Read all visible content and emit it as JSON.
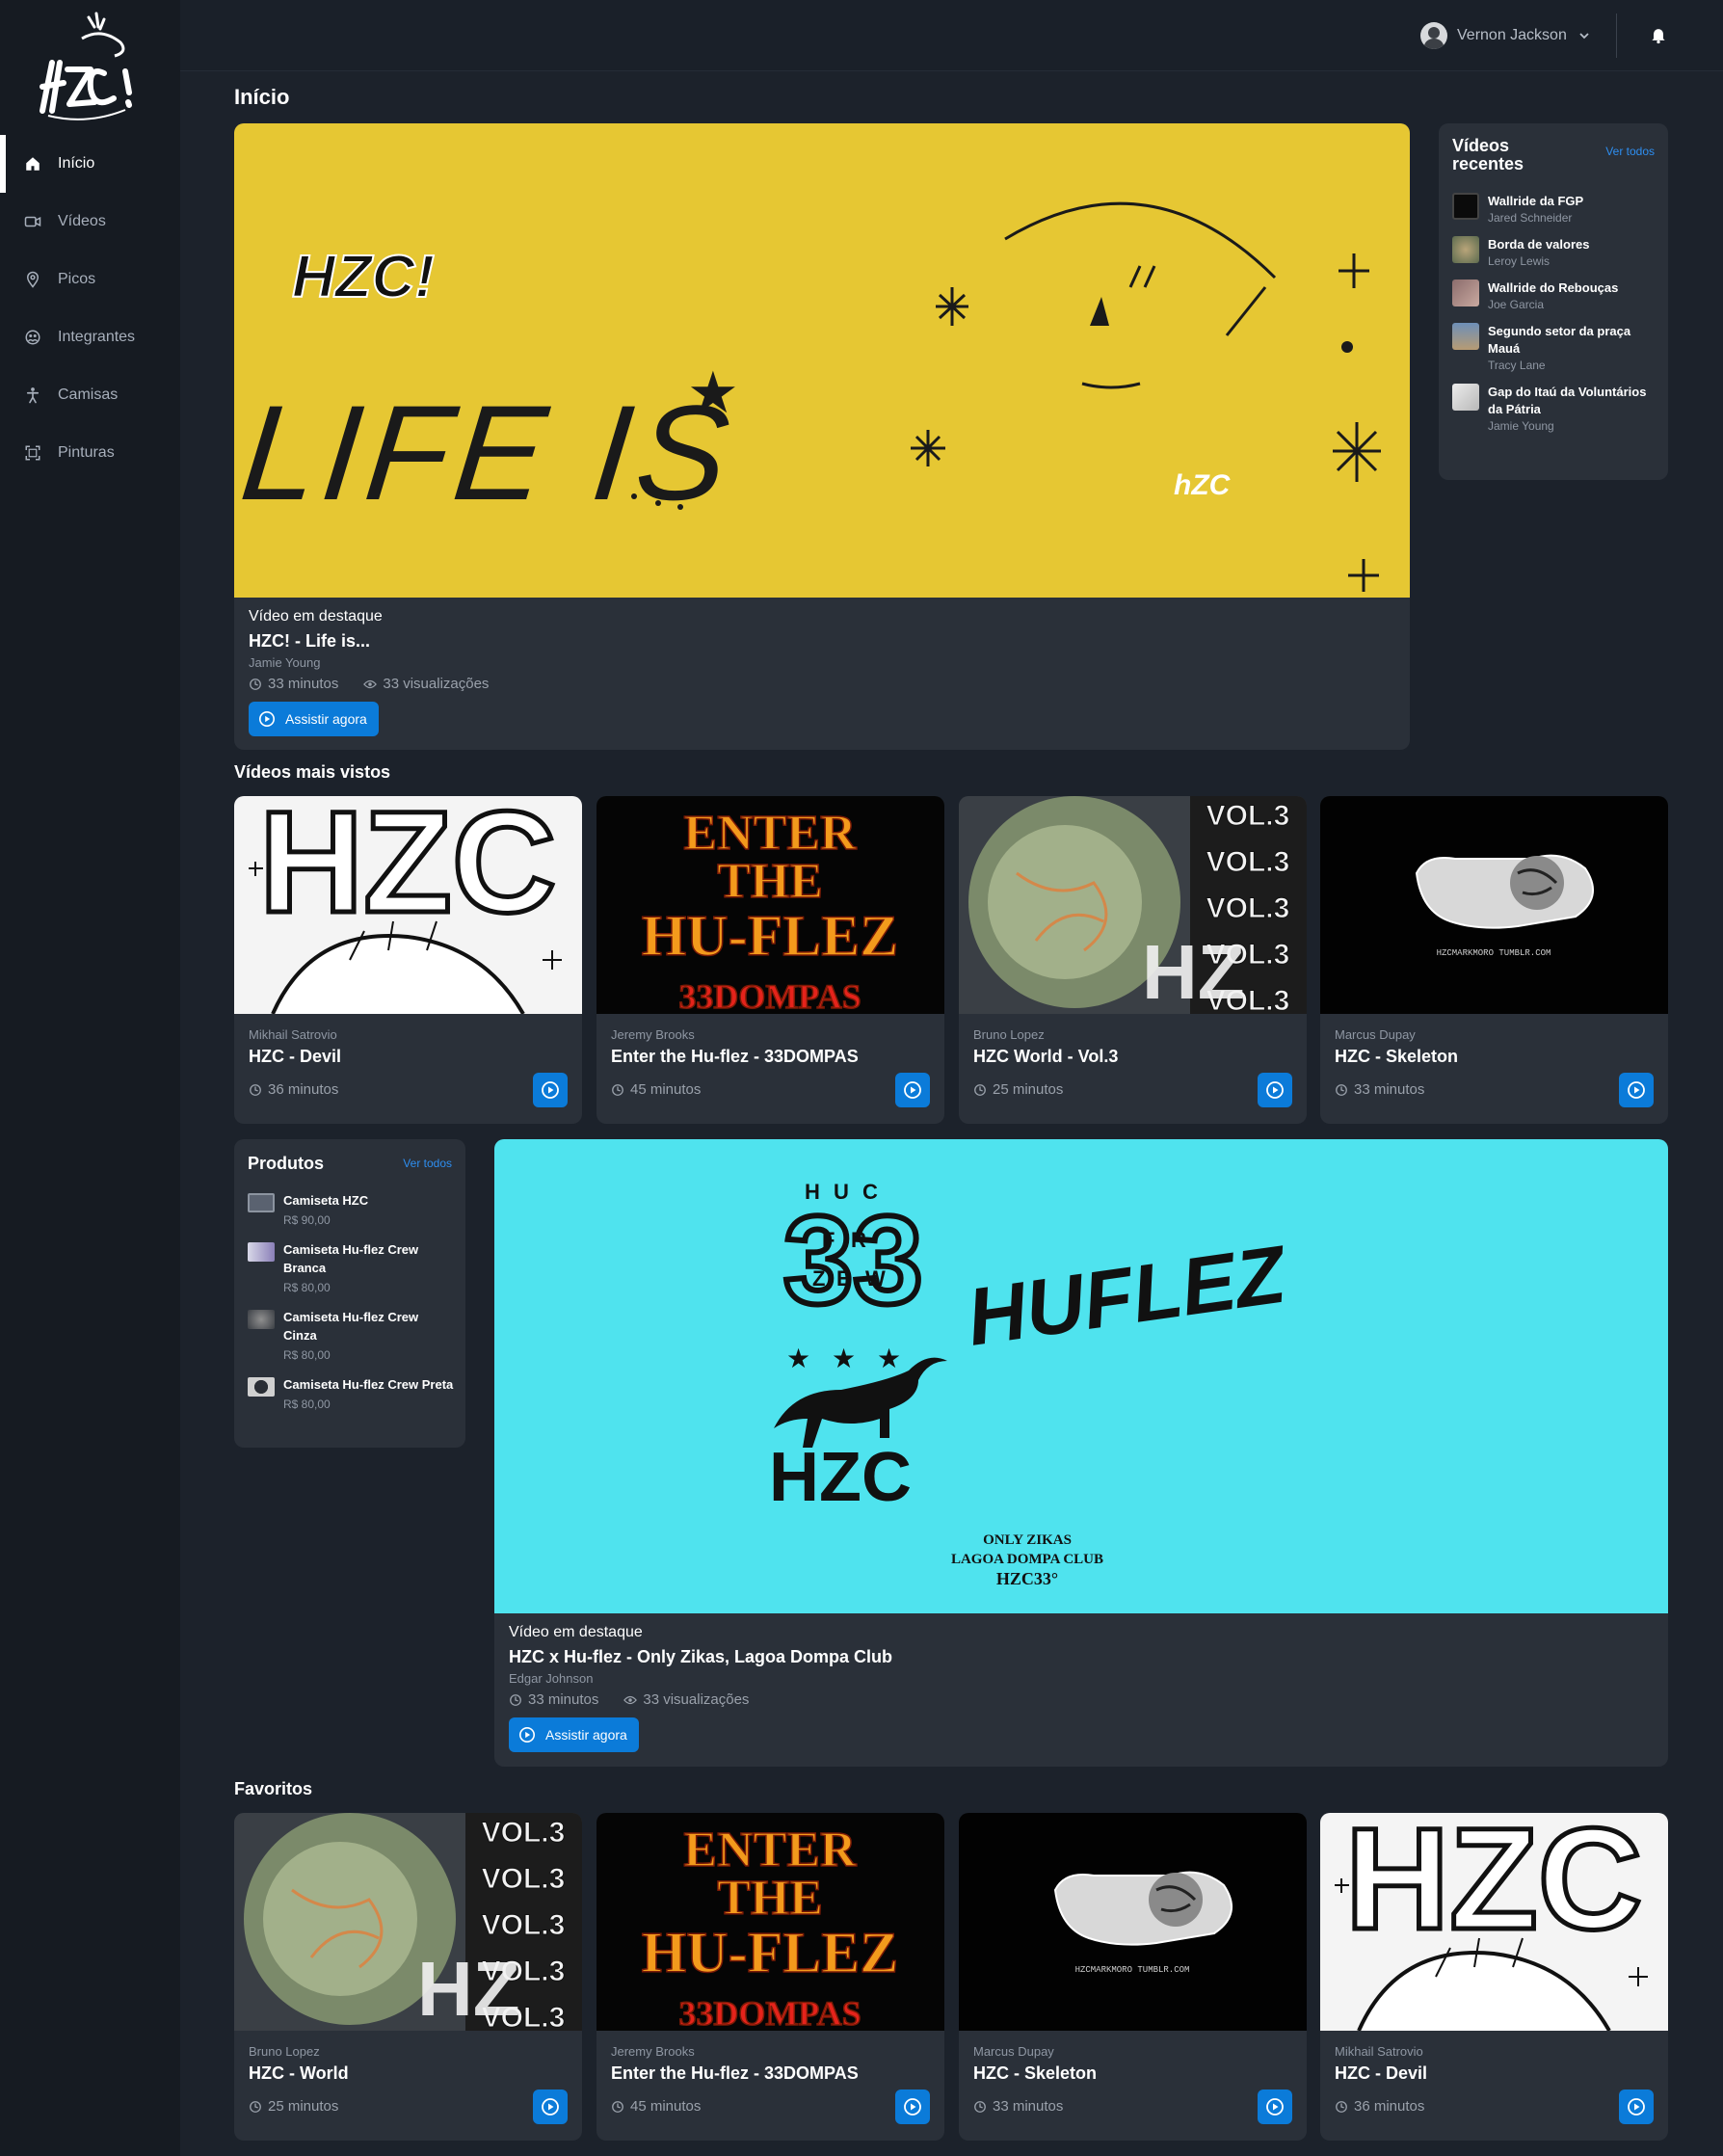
{
  "user": {
    "name": "Vernon Jackson"
  },
  "sidebar": {
    "items": [
      {
        "label": "Início",
        "icon": "home-icon",
        "active": true
      },
      {
        "label": "Vídeos",
        "icon": "video-icon"
      },
      {
        "label": "Picos",
        "icon": "map-pin-icon"
      },
      {
        "label": "Integrantes",
        "icon": "users-icon"
      },
      {
        "label": "Camisas",
        "icon": "person-icon"
      },
      {
        "label": "Pinturas",
        "icon": "gallery-icon"
      }
    ]
  },
  "page": {
    "title": "Início"
  },
  "featured": [
    {
      "kicker": "Vídeo em destaque",
      "title": "HZC! - Life is...",
      "author": "Jamie Young",
      "duration": "33 minutos",
      "views": "33 visualizações",
      "cta": "Assistir agora",
      "art_text": "LIFE IS",
      "art_color": "#e6c733"
    },
    {
      "kicker": "Vídeo em destaque",
      "title": "HZC x Hu-flez - Only Zikas, Lagoa Dompa Club",
      "author": "Edgar Johnson",
      "duration": "33 minutos",
      "views": "33 visualizações",
      "cta": "Assistir agora",
      "art_text_big": "HUFLEZ",
      "art_text_hzc": "HZC",
      "art_badge": "33",
      "art_caption": [
        "ONLY ZIKAS",
        "LAGOA DOMPA CLUB",
        "HZC33°"
      ],
      "art_color": "#4fe3ee"
    }
  ],
  "recent": {
    "title": "Vídeos recentes",
    "see_all": "Ver todos",
    "items": [
      {
        "title": "Wallride da FGP",
        "author": "Jared Schneider"
      },
      {
        "title": "Borda de valores",
        "author": "Leroy Lewis"
      },
      {
        "title": "Wallride do Rebouças",
        "author": "Joe Garcia"
      },
      {
        "title": "Segundo setor da praça Mauá",
        "author": "Tracy Lane"
      },
      {
        "title": "Gap do Itaú da Voluntários da Pátria",
        "author": "Jamie Young"
      }
    ]
  },
  "most_viewed": {
    "title": "Vídeos mais vistos",
    "items": [
      {
        "author": "Mikhail Satrovio",
        "title": "HZC - Devil",
        "duration": "36 minutos",
        "thumb": "devil"
      },
      {
        "author": "Jeremy Brooks",
        "title": "Enter the Hu-flez - 33DOMPAS",
        "duration": "45 minutos",
        "thumb": "enter"
      },
      {
        "author": "Bruno Lopez",
        "title": "HZC World - Vol.3",
        "duration": "25 minutos",
        "thumb": "world"
      },
      {
        "author": "Marcus Dupay",
        "title": "HZC - Skeleton",
        "duration": "33 minutos",
        "thumb": "skeleton"
      }
    ]
  },
  "products": {
    "title": "Produtos",
    "see_all": "Ver todos",
    "items": [
      {
        "title": "Camiseta HZC",
        "price": "R$ 90,00"
      },
      {
        "title": "Camiseta Hu-flez Crew Branca",
        "price": "R$ 80,00"
      },
      {
        "title": "Camiseta Hu-flez Crew Cinza",
        "price": "R$ 80,00"
      },
      {
        "title": "Camiseta Hu-flez Crew Preta",
        "price": "R$ 80,00"
      }
    ]
  },
  "favorites": {
    "title": "Favoritos",
    "items": [
      {
        "author": "Bruno Lopez",
        "title": "HZC - World",
        "duration": "25 minutos",
        "thumb": "world"
      },
      {
        "author": "Jeremy Brooks",
        "title": "Enter the Hu-flez - 33DOMPAS",
        "duration": "45 minutos",
        "thumb": "enter"
      },
      {
        "author": "Marcus Dupay",
        "title": "HZC - Skeleton",
        "duration": "33 minutos",
        "thumb": "skeleton"
      },
      {
        "author": "Mikhail Satrovio",
        "title": "HZC - Devil",
        "duration": "36 minutos",
        "thumb": "devil"
      }
    ]
  },
  "thumb_text": {
    "enter": [
      "ENTER",
      "THE",
      "HU-FLEZ",
      "33DOMPAS"
    ],
    "world": [
      "VOL.3",
      "VOL.3",
      "VOL.3",
      "VOL.3",
      "VOL.3"
    ],
    "devil": "HZC",
    "skeleton": "HZCMARKMORO TUMBLR.COM"
  },
  "colors": {
    "accent": "#0b7bd9",
    "link": "#2e8ef0",
    "card": "#2a3039",
    "background": "#1c222b",
    "sidebar": "#161b22"
  }
}
